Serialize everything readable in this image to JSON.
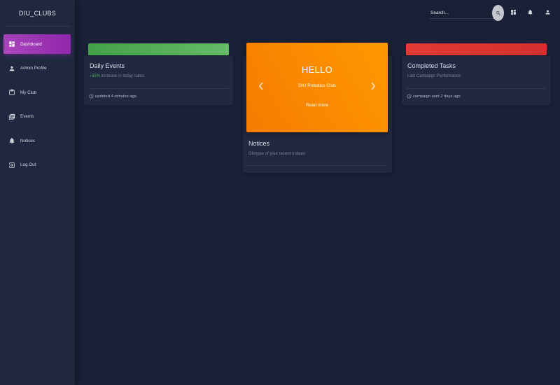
{
  "brand": "DIU_CLUBS",
  "sidebar": {
    "items": [
      {
        "label": "Dashboard",
        "icon": "dashboard-icon",
        "active": true
      },
      {
        "label": "Admin Profile",
        "icon": "person-icon"
      },
      {
        "label": "My Club",
        "icon": "clipboard-icon"
      },
      {
        "label": "Events",
        "icon": "library-books-icon"
      },
      {
        "label": "Notices",
        "icon": "bell-icon"
      },
      {
        "label": "Log Out",
        "icon": "logout-icon"
      }
    ]
  },
  "header": {
    "search_placeholder": "Search...",
    "icons": [
      "search-icon",
      "dashboard-icon",
      "bell-icon",
      "person-icon"
    ]
  },
  "cards": {
    "daily": {
      "title": "Daily Events",
      "percent": "55%",
      "category_rest": " increase in today sales.",
      "footer": "updated 4 minutes ago",
      "header_color": "#4caf50"
    },
    "notices": {
      "title": "Notices",
      "category": "Glimpse of your recent notices",
      "slide_title": "HELLO",
      "slide_subtitle": "DIU Robotics Club",
      "slide_link": "Read more",
      "header_color": "#ff9800"
    },
    "tasks": {
      "title": "Completed Tasks",
      "category": "Last Campaign Performance",
      "footer": "campaign sent 2 days ago",
      "header_color": "#e53935"
    }
  },
  "colors": {
    "background": "#1a2035",
    "sidebar": "#1f283e",
    "card": "#202940",
    "active_accent": "#9c27b0"
  }
}
